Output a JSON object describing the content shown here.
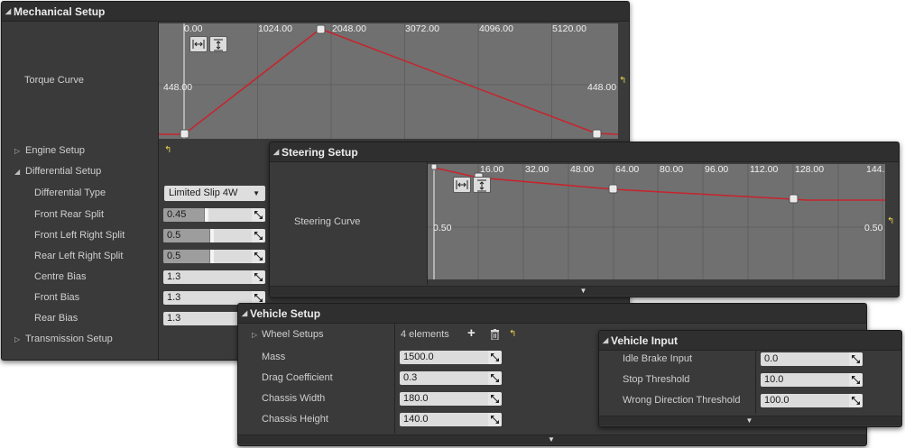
{
  "mechanical": {
    "title": "Mechanical Setup",
    "torque_label": "Torque Curve",
    "torque_ticks": [
      "0.00",
      "1024.00",
      "2048.00",
      "3072.00",
      "4096.00",
      "5120.00"
    ],
    "torque_left_value": "448.00",
    "torque_right_value": "448.00",
    "engine_setup": "Engine Setup",
    "differential_setup": "Differential Setup",
    "differential_type_label": "Differential Type",
    "differential_type_value": "Limited Slip 4W",
    "front_rear_split_label": "Front Rear Split",
    "front_rear_split_value": "0.45",
    "front_left_right_split_label": "Front Left Right Split",
    "front_left_right_split_value": "0.5",
    "rear_left_right_split_label": "Rear Left Right Split",
    "rear_left_right_split_value": "0.5",
    "centre_bias_label": "Centre Bias",
    "centre_bias_value": "1.3",
    "front_bias_label": "Front Bias",
    "front_bias_value": "1.3",
    "rear_bias_label": "Rear Bias",
    "rear_bias_value": "1.3",
    "transmission_setup": "Transmission Setup"
  },
  "steering": {
    "title": "Steering Setup",
    "curve_label": "Steering Curve",
    "ticks": [
      "16.00",
      "32.00",
      "48.00",
      "64.00",
      "80.00",
      "96.00",
      "112.00",
      "128.00",
      "144."
    ],
    "left_value": "0.50",
    "right_value": "0.50"
  },
  "vehicle": {
    "title": "Vehicle Setup",
    "wheel_setups_label": "Wheel Setups",
    "wheel_setups_value": "4 elements",
    "mass_label": "Mass",
    "mass_value": "1500.0",
    "drag_label": "Drag Coefficient",
    "drag_value": "0.3",
    "chassis_width_label": "Chassis Width",
    "chassis_width_value": "180.0",
    "chassis_height_label": "Chassis Height",
    "chassis_height_value": "140.0"
  },
  "input": {
    "title": "Vehicle Input",
    "idle_brake_label": "Idle Brake Input",
    "idle_brake_value": "0.0",
    "stop_threshold_label": "Stop Threshold",
    "stop_threshold_value": "10.0",
    "wrong_direction_label": "Wrong Direction Threshold",
    "wrong_direction_value": "100.0"
  },
  "icons": {
    "collapse": "triangle-down-icon",
    "expand": "triangle-right-icon",
    "reset": "reset-arrow-icon",
    "add": "plus-icon",
    "delete": "trash-icon",
    "fit_horizontal": "fit-horizontal-icon",
    "fit_vertical": "fit-vertical-icon",
    "spin_handle": "spin-arrows-icon"
  },
  "colors": {
    "panel_bg": "#3a3a3a",
    "header_bg": "#2f2f2f",
    "graph_bg": "#707070",
    "curve": "#c8232c",
    "field_bg": "#dcdcdc",
    "reset_icon": "#e8d04a"
  }
}
